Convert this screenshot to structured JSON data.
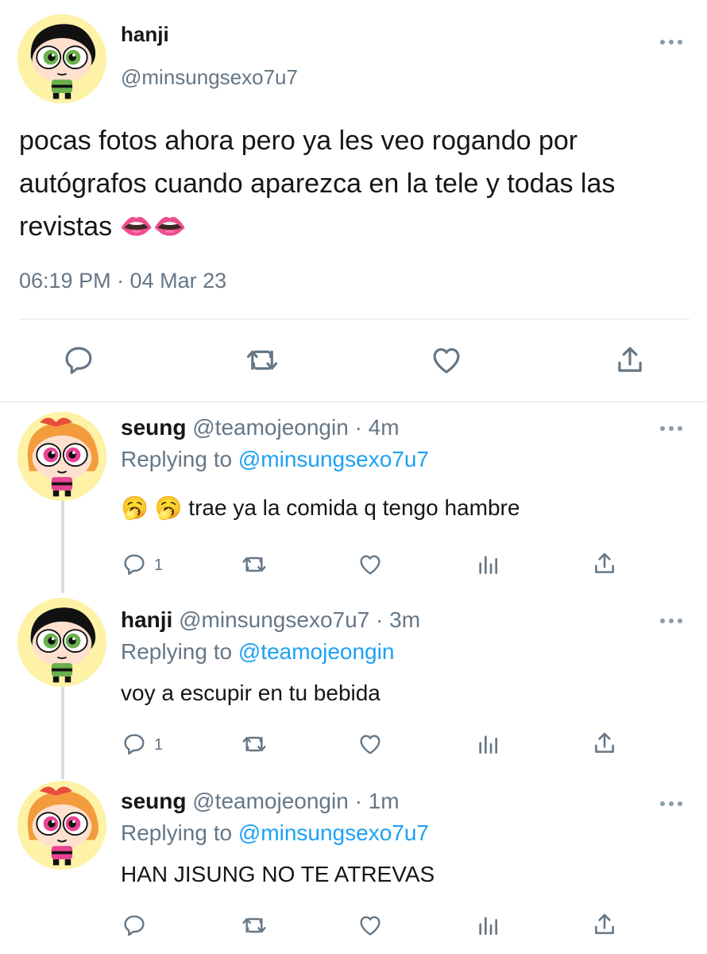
{
  "main_tweet": {
    "name": "hanji",
    "handle": "@minsungsexo7u7",
    "text": "pocas fotos ahora pero ya les veo rogando por autógrafos cuando aparezca en la tele y todas las revistas 👄👄",
    "timestamp": "06:19 PM · 04 Mar 23",
    "avatar": "buttercup-avatar",
    "actions": [
      "reply-icon",
      "retweet-icon",
      "like-icon",
      "share-icon"
    ]
  },
  "replies": [
    {
      "name": "seung",
      "handle": "@teamojeongin",
      "time": "· 4m",
      "replying_label": "Replying to",
      "replying_to": "@minsungsexo7u7",
      "text": "🥱 🥱  trae ya la comida q tengo hambre",
      "reply_count": "1",
      "avatar": "blossom-avatar"
    },
    {
      "name": "hanji",
      "handle": "@minsungsexo7u7",
      "time": "· 3m",
      "replying_label": "Replying to",
      "replying_to": "@teamojeongin",
      "text": "voy a escupir en tu bebida",
      "reply_count": "1",
      "avatar": "buttercup-avatar"
    },
    {
      "name": "seung",
      "handle": "@teamojeongin",
      "time": "· 1m",
      "replying_label": "Replying to",
      "replying_to": "@minsungsexo7u7",
      "text": "HAN JISUNG NO TE ATREVAS",
      "reply_count": "",
      "avatar": "blossom-avatar"
    }
  ],
  "colors": {
    "text": "#14171a",
    "muted": "#657786",
    "link": "#1da1f2",
    "avatar_bg": "#fdf2a6",
    "divider": "#e1e8ed"
  }
}
